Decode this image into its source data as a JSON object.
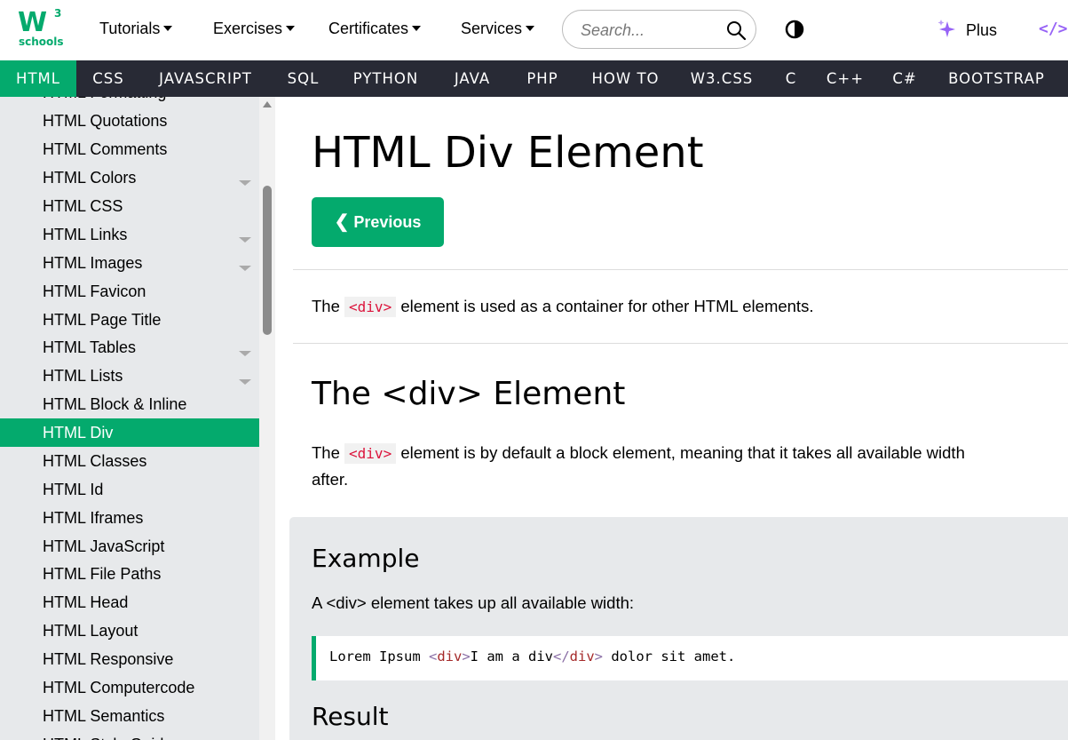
{
  "logo": {
    "mark": "W",
    "sup": "3",
    "text": "schools"
  },
  "topnav": {
    "items": [
      "Tutorials",
      "Exercises",
      "Certificates",
      "Services"
    ],
    "search_placeholder": "Search...",
    "plus_label": "Plus",
    "code_icon": "</>"
  },
  "langbar": [
    "HTML",
    "CSS",
    "JAVASCRIPT",
    "SQL",
    "PYTHON",
    "JAVA",
    "PHP",
    "HOW TO",
    "W3.CSS",
    "C",
    "C++",
    "C#",
    "BOOTSTRAP"
  ],
  "sidebar": {
    "items": [
      "HTML Formatting",
      "HTML Quotations",
      "HTML Comments",
      "HTML Colors",
      "HTML CSS",
      "HTML Links",
      "HTML Images",
      "HTML Favicon",
      "HTML Page Title",
      "HTML Tables",
      "HTML Lists",
      "HTML Block & Inline",
      "HTML Div",
      "HTML Classes",
      "HTML Id",
      "HTML Iframes",
      "HTML JavaScript",
      "HTML File Paths",
      "HTML Head",
      "HTML Layout",
      "HTML Responsive",
      "HTML Computercode",
      "HTML Semantics",
      "HTML Style Guide"
    ],
    "active": "HTML Div"
  },
  "main": {
    "title": "HTML Div Element",
    "prev_label": "Previous",
    "intro_before": "The ",
    "intro_code": "<div>",
    "intro_after": " element is used as a container for other HTML elements.",
    "section_title": "The <div> Element",
    "section_before": "The ",
    "section_code": "<div>",
    "section_after": " element is by default a block element, meaning that it takes all available width",
    "section_line2": "after.",
    "example": {
      "heading": "Example",
      "desc": "A <div> element takes up all available width:",
      "code_pre": "Lorem Ipsum ",
      "code_open_lt": "<",
      "code_open_tag": "div",
      "code_open_gt": ">",
      "code_text": "I am a div",
      "code_close_lt": "</",
      "code_close_tag": "div",
      "code_close_gt": ">",
      "code_post": " dolor sit amet.",
      "result_heading": "Result"
    }
  },
  "colors": {
    "accent": "#04aa6d",
    "langbar_bg": "#282a35",
    "sidebar_bg": "#e7e9eb",
    "plus_icon": "#9763f6"
  }
}
